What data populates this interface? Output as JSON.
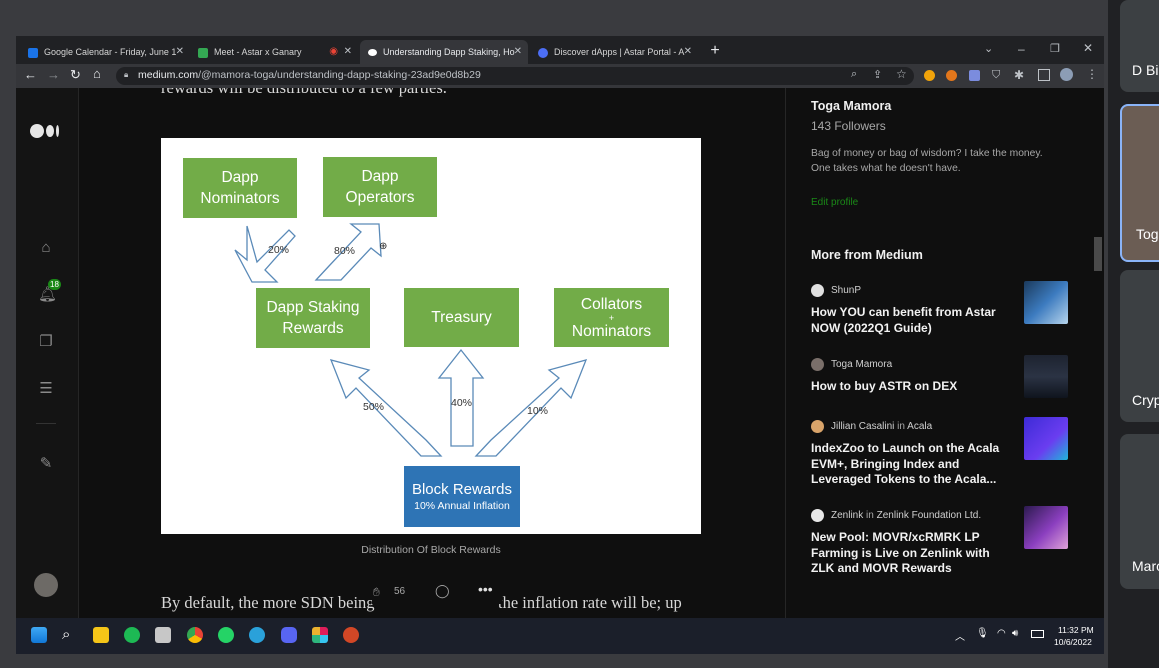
{
  "browser": {
    "tabs": [
      {
        "title": "Google Calendar - Friday, June 1",
        "fav_color": "#1a73e8"
      },
      {
        "title": "Meet - Astar x Ganary",
        "fav_color": "#34a853"
      },
      {
        "title": "Understanding Dapp Staking, Ho",
        "fav_color": "#ffffff"
      },
      {
        "title": "Discover dApps | Astar Portal - A",
        "fav_color": "#4c6ef5"
      }
    ],
    "url_host": "medium.com",
    "url_path": "/@mamora-toga/understanding-dapp-staking-23ad9e0d8b29"
  },
  "meet": {
    "tiles": [
      "D Bi",
      "Tog",
      "Cryp",
      "Marc"
    ]
  },
  "article": {
    "top_line": "rewards will be distributed to a few parties.",
    "caption": "Distribution Of Block Rewards",
    "bottom_line": "By default, the more SDN being",
    "bottom_line_end": "the inflation rate will be; up",
    "clap_count": "56"
  },
  "diagram": {
    "nominators": "Dapp\nNominators",
    "operators": "Dapp\nOperators",
    "staking_rewards": "Dapp Staking\nRewards",
    "treasury": "Treasury",
    "collators_top": "Collators",
    "collators_plus": "+",
    "collators_bottom": "Nominators",
    "block_rewards": "Block Rewards",
    "inflation": "10% Annual Inflation",
    "p20": "20%",
    "p80": "80%",
    "p50": "50%",
    "p40": "40%",
    "p10": "10%"
  },
  "rail": {
    "notification_count": "18"
  },
  "sidebar": {
    "author_name": "Toga Mamora",
    "followers": "143 Followers",
    "bio": "Bag of money or bag of wisdom? I take the money. One takes what he doesn't have.",
    "edit_profile": "Edit profile",
    "more_heading": "More from Medium",
    "stories": [
      {
        "author": "ShunP",
        "pub": "",
        "title": "How YOU can benefit from Astar NOW (2022Q1 Guide)"
      },
      {
        "author": "Toga Mamora",
        "pub": "",
        "title": "How to buy ASTR on DEX"
      },
      {
        "author": "Jillian Casalini",
        "pub": "Acala",
        "title": "IndexZoo to Launch on the Acala EVM+, Bringing Index and Leveraged Tokens to the Acala..."
      },
      {
        "author": "Zenlink",
        "pub": "Zenlink Foundation Ltd.",
        "title": "New Pool: MOVR/xcRMRK LP Farming is Live on Zenlink with ZLK and MOVR Rewards"
      }
    ],
    "in_word": "in"
  },
  "taskbar": {
    "time": "11:32 PM",
    "date": "10/6/2022"
  },
  "colors": {
    "medium_green": "#1a8917",
    "diagram_green": "#72ac48",
    "diagram_blue": "#2e74b5"
  }
}
